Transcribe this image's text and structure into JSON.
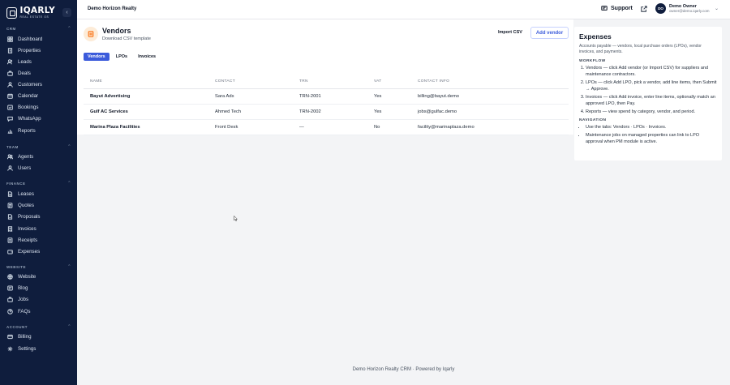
{
  "brand": {
    "logo_word": "IQARLY",
    "logo_sub": "REAL ESTATE OS"
  },
  "sidebar": {
    "sections": [
      {
        "title": "CRM",
        "items": [
          {
            "label": "Dashboard",
            "icon": "grid-icon"
          },
          {
            "label": "Properties",
            "icon": "building-icon"
          },
          {
            "label": "Leads",
            "icon": "users-icon"
          },
          {
            "label": "Deals",
            "icon": "briefcase-icon"
          },
          {
            "label": "Customers",
            "icon": "person-icon"
          },
          {
            "label": "Calendar",
            "icon": "calendar-icon"
          },
          {
            "label": "Bookings",
            "icon": "bookmark-icon"
          },
          {
            "label": "WhatsApp",
            "icon": "chat-icon"
          },
          {
            "label": "Reports",
            "icon": "chart-icon"
          }
        ]
      },
      {
        "title": "TEAM",
        "items": [
          {
            "label": "Agents",
            "icon": "people-icon"
          },
          {
            "label": "Users",
            "icon": "person-icon"
          }
        ]
      },
      {
        "title": "FINANCE",
        "items": [
          {
            "label": "Leases",
            "icon": "doc-icon"
          },
          {
            "label": "Quotes",
            "icon": "quote-icon"
          },
          {
            "label": "Proposals",
            "icon": "proposal-icon"
          },
          {
            "label": "Invoices",
            "icon": "invoice-icon"
          },
          {
            "label": "Receipts",
            "icon": "receipt-icon"
          },
          {
            "label": "Expenses",
            "icon": "wallet-icon"
          }
        ]
      },
      {
        "title": "WEBSITE",
        "items": [
          {
            "label": "Website",
            "icon": "globe-icon"
          },
          {
            "label": "Blog",
            "icon": "blog-icon"
          },
          {
            "label": "Jobs",
            "icon": "briefcase-icon"
          },
          {
            "label": "FAQs",
            "icon": "help-icon"
          }
        ]
      },
      {
        "title": "ACCOUNT",
        "items": [
          {
            "label": "Billing",
            "icon": "card-icon"
          },
          {
            "label": "Settings",
            "icon": "gear-icon"
          }
        ]
      }
    ]
  },
  "topbar": {
    "tenant": "Demo Horizon Realty",
    "support_label": "Support",
    "avatar_initials": "DO",
    "user_name": "Demo Owner",
    "user_email": "owner@demo.iqarly.com"
  },
  "page": {
    "title": "Vendors",
    "subtitle": "Download CSV template",
    "import_label": "Import CSV",
    "add_label": "Add vendor",
    "tabs": [
      {
        "label": "Vendors",
        "active": true
      },
      {
        "label": "LPOs",
        "active": false
      },
      {
        "label": "Invoices",
        "active": false
      }
    ]
  },
  "table": {
    "columns": [
      "NAME",
      "CONTACT",
      "TRN",
      "VAT",
      "CONTACT INFO"
    ],
    "rows": [
      [
        "Bayut Advertising",
        "Sara Ads",
        "TRN-2001",
        "Yes",
        "billing@bayut.demo"
      ],
      [
        "Gulf AC Services",
        "Ahmed Tech",
        "TRN-2002",
        "Yes",
        "jobs@gulfac.demo"
      ],
      [
        "Marina Plaza Facilities",
        "Front Desk",
        "—",
        "No",
        "facility@marinaplaza.demo"
      ]
    ]
  },
  "panel": {
    "title": "Expenses",
    "description": "Accounts payable — vendors, local purchase orders (LPOs), vendor invoices, and payments.",
    "workflow_heading": "WORKFLOW",
    "workflow": [
      "Vendors — click Add vendor (or Import CSV) for suppliers and maintenance contractors.",
      "LPOs — click Add LPO, pick a vendor, add line items, then Submit → Approve.",
      "Invoices — click Add invoice, enter line items, optionally match an approved LPO, then Pay.",
      "Reports — view spend by category, vendor, and period."
    ],
    "navigation_heading": "NAVIGATION",
    "navigation": [
      "Use the tabs: Vendors · LPOs · Invoices.",
      "Maintenance jobs on managed properties can link to LPO approval when PM module is active."
    ]
  },
  "footer": {
    "text": "Demo Horizon Realty CRM · Powered by Iqarly"
  }
}
